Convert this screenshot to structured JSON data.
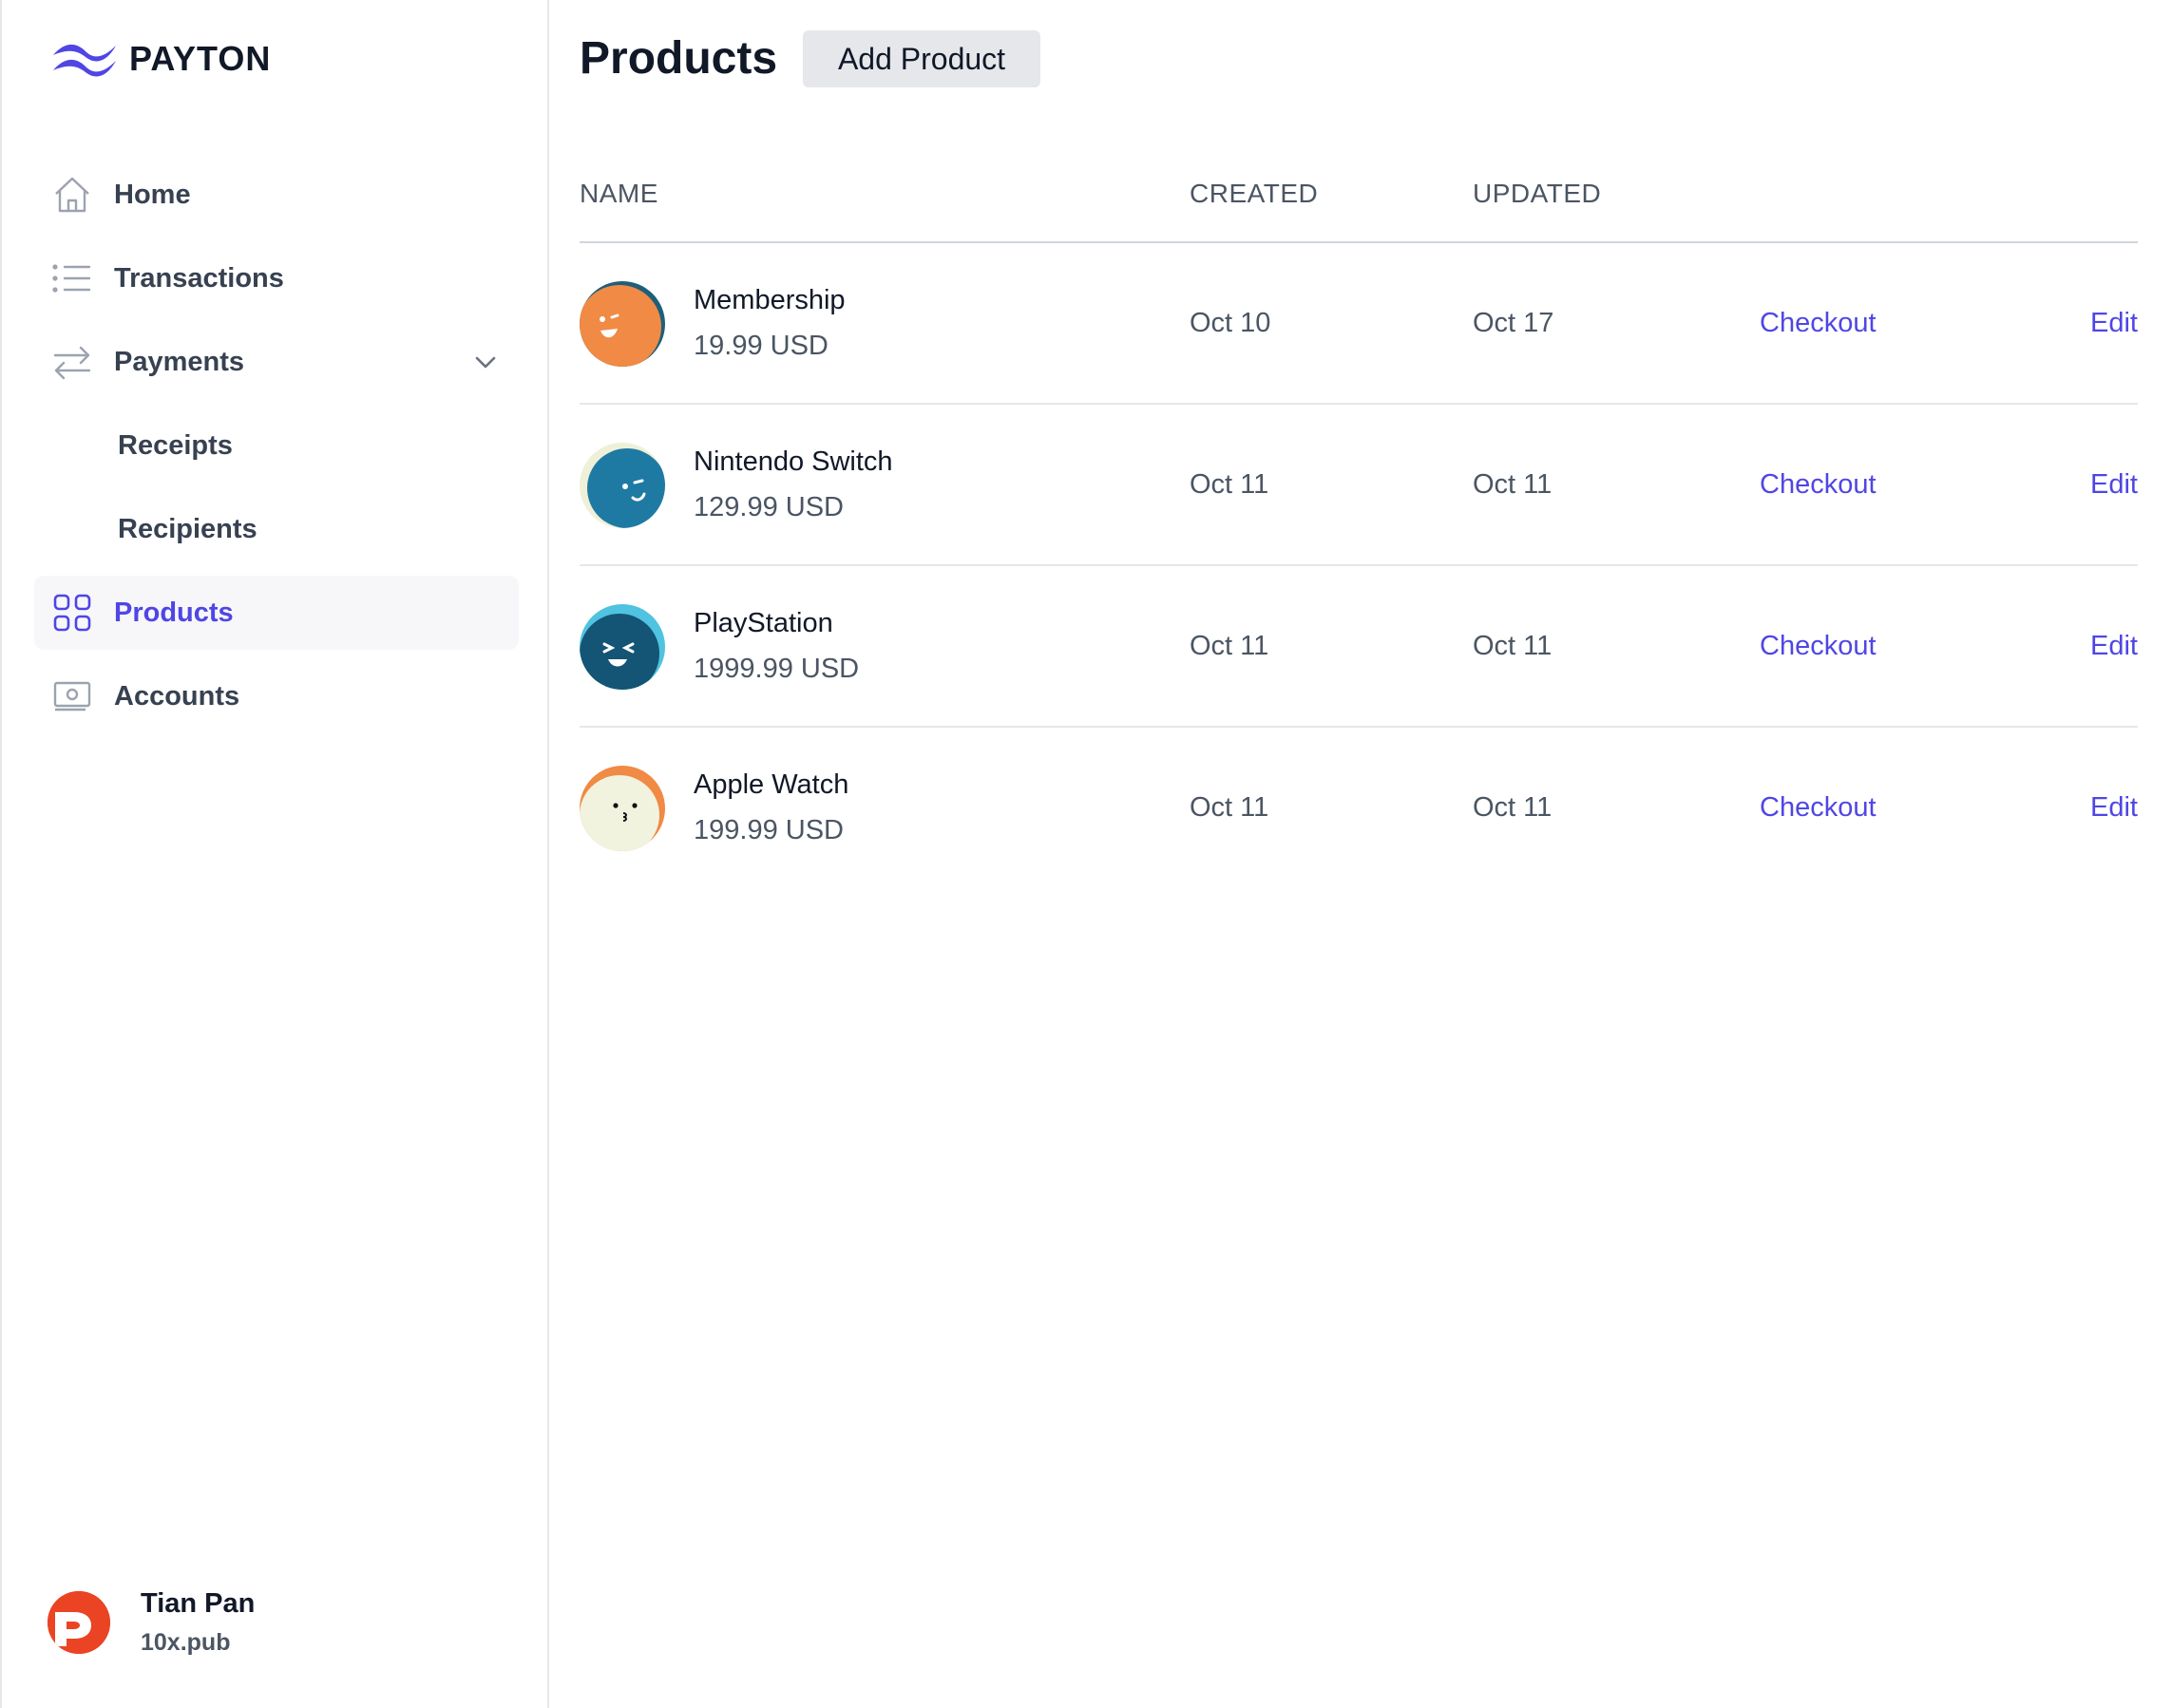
{
  "brand": {
    "name": "PAYTON",
    "accent": "#4f46e5"
  },
  "sidebar": {
    "items": [
      {
        "label": "Home",
        "icon": "home-icon"
      },
      {
        "label": "Transactions",
        "icon": "list-icon"
      },
      {
        "label": "Payments",
        "icon": "arrows-exchange-icon",
        "expanded": true
      },
      {
        "label": "Receipts"
      },
      {
        "label": "Recipients"
      },
      {
        "label": "Products",
        "icon": "grid-icon",
        "active": true
      },
      {
        "label": "Accounts",
        "icon": "cash-icon"
      }
    ]
  },
  "user": {
    "name": "Tian Pan",
    "handle": "10x.pub"
  },
  "page": {
    "title": "Products",
    "add_button": "Add Product"
  },
  "table": {
    "headers": {
      "name": "NAME",
      "created": "CREATED",
      "updated": "UPDATED"
    },
    "rows": [
      {
        "name": "Membership",
        "price": "19.99 USD",
        "created": "Oct 10",
        "updated": "Oct 17",
        "checkout": "Checkout",
        "edit": "Edit",
        "avatar_bg": "#f08a44",
        "avatar_ring": "#1e5f7a"
      },
      {
        "name": "Nintendo Switch",
        "price": "129.99 USD",
        "created": "Oct 11",
        "updated": "Oct 11",
        "checkout": "Checkout",
        "edit": "Edit",
        "avatar_bg": "#1f7aa3",
        "avatar_ring": "#eef0d8"
      },
      {
        "name": "PlayStation",
        "price": "1999.99 USD",
        "created": "Oct 11",
        "updated": "Oct 11",
        "checkout": "Checkout",
        "edit": "Edit",
        "avatar_bg": "#145474",
        "avatar_ring": "#4fc3e0"
      },
      {
        "name": "Apple Watch",
        "price": "199.99 USD",
        "created": "Oct 11",
        "updated": "Oct 11",
        "checkout": "Checkout",
        "edit": "Edit",
        "avatar_bg": "#f1f3df",
        "avatar_ring": "#f08a44"
      }
    ]
  }
}
